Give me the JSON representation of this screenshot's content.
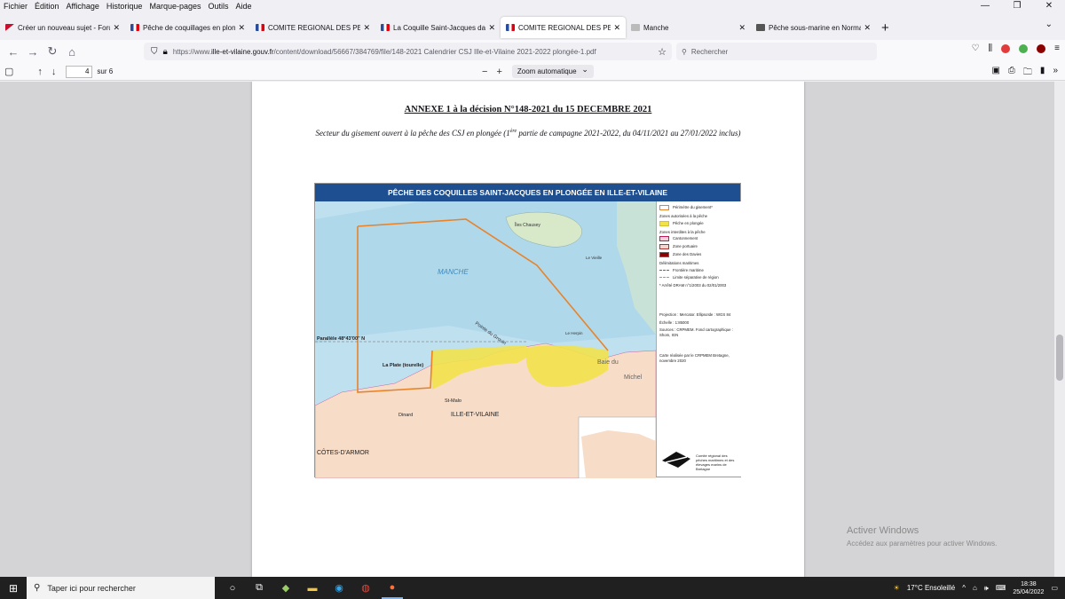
{
  "menubar": [
    "Fichier",
    "Édition",
    "Affichage",
    "Historique",
    "Marque-pages",
    "Outils",
    "Aide"
  ],
  "tabs": [
    {
      "label": "Créer un nouveau sujet - Forum",
      "fav_color": "#c8102e",
      "active": false
    },
    {
      "label": "Pêche de coquillages en plongée",
      "fav_color": "#2a4d9b",
      "active": false
    },
    {
      "label": "COMITE REGIONAL DES PECHES",
      "fav_color": "#2a4d9b",
      "active": false
    },
    {
      "label": "La Coquille Saint-Jacques dans",
      "fav_color": "#2a4d9b",
      "active": false
    },
    {
      "label": "COMITE REGIONAL DES PECHES",
      "fav_color": "#2a4d9b",
      "active": true
    },
    {
      "label": "Manche",
      "fav_color": "#888888",
      "active": false
    },
    {
      "label": "Pêche sous-marine en Normandie",
      "fav_color": "#555555",
      "active": false
    }
  ],
  "url": {
    "prefix": "https://www.",
    "domain": "ille-et-vilaine.gouv.fr",
    "path": "/content/download/56667/384769/file/148-2021 Calendrier CSJ Ille-et-Vilaine 2021-2022 plongée-1.pdf"
  },
  "search_placeholder": "Rechercher",
  "pdf": {
    "page_number": "4",
    "page_count": "sur 6",
    "zoom": "Zoom automatique"
  },
  "document": {
    "title": "ANNEXE 1 à la décision N°148-2021 du 15 DECEMBRE 2021",
    "subtitle_a": "Secteur du gisement ouvert à la pêche des CSJ en plongée (1",
    "subtitle_sup": "ère",
    "subtitle_b": " partie de campagne 2021-2022, du 04/11/2021 au 27/01/2022 inclus)"
  },
  "map": {
    "header": "PÊCHE DES COQUILLES SAINT-JACQUES EN PLONGÉE EN ILLE-ET-VILAINE",
    "labels": {
      "manche": "MANCHE",
      "chausey": "Îles Chausey",
      "parallel": "Parallèle 48°43'00'' N",
      "plate": "La Plate (tourelle)",
      "stmalo": "St-Malo",
      "dinard": "Dinard",
      "ille": "ILLE-ET-VILAINE",
      "cotes": "CÔTES-D'ARMOR",
      "baie": "Baie du",
      "michel": "Michel",
      "pointe": "Pointe du Grouin",
      "vieille": "Le Vieille",
      "herpin": "Le Herpin"
    },
    "colors": {
      "sea": "#bfe0ef",
      "deep_sea": "#a9d4ea",
      "land": "#f7dcc7",
      "zone": "#f2e24a",
      "perimeter": "#e8832a",
      "header_bg": "#1d4f91"
    },
    "legend": {
      "perimeter": "Périmètre du gisement*",
      "authorized": "Zones autorisées à la pêche",
      "dive": "Pêche en plongée",
      "forbidden": "Zones interdites à la pêche",
      "canton": "Cantonnement",
      "port": "Zone portuaire",
      "davies": "Zone des Davies",
      "limits": "Délimitations maritimes",
      "border": "Frontière maritime",
      "region_limit": "Limite séparative de région",
      "arrete": "* Arrêté DRAM n°1/2003 du 02/01/2003",
      "projection": "Projection : Mercator. Ellipsoïde : WGS 84",
      "scale": "Échelle : 1:85000",
      "sources": "Sources : CRPMEM. Fond cartographique : Shom, IGN",
      "credit": "Carte réalisée par le CRPMEM Bretagne, novembre 2020",
      "logo_text": "Comité régional des pêches maritimes et des élevages marins de Bretagne"
    }
  },
  "activate": {
    "title": "Activer Windows",
    "sub": "Accédez aux paramètres pour activer Windows."
  },
  "taskbar": {
    "search": "Taper ici pour rechercher",
    "weather": "17°C Ensoleillé",
    "time": "18:38",
    "date": "25/04/2022"
  }
}
